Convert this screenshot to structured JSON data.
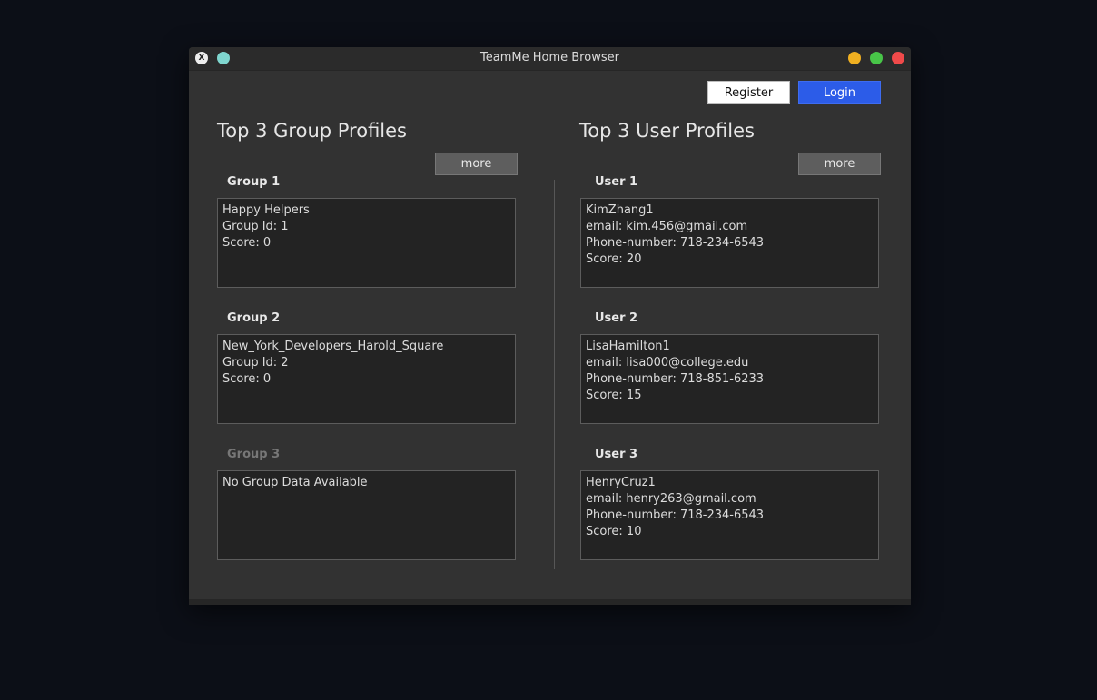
{
  "window": {
    "title": "TeamMe Home Browser",
    "close_glyph": "X",
    "colors": {
      "minimize": "#f0b021",
      "maximize": "#48c548",
      "close": "#f04a4a",
      "pin": "#7fd6cf"
    }
  },
  "header": {
    "register_label": "Register",
    "login_label": "Login",
    "login_color": "#2c5ce8"
  },
  "groups": {
    "title": "Top 3 Group Profiles",
    "more_label": "more",
    "items": [
      {
        "label": "Group 1",
        "lines": [
          "Happy Helpers",
          "Group Id: 1",
          "Score: 0"
        ],
        "enabled": true
      },
      {
        "label": "Group 2",
        "lines": [
          "New_York_Developers_Harold_Square",
          "Group Id: 2",
          "Score: 0"
        ],
        "enabled": true
      },
      {
        "label": "Group 3",
        "lines": [
          "No Group Data Available"
        ],
        "enabled": false
      }
    ]
  },
  "users": {
    "title": "Top 3 User Profiles",
    "more_label": "more",
    "items": [
      {
        "label": "User 1",
        "lines": [
          "KimZhang1",
          "email: kim.456@gmail.com",
          "Phone-number: 718-234-6543",
          "Score: 20"
        ],
        "enabled": true
      },
      {
        "label": "User 2",
        "lines": [
          "LisaHamilton1",
          "email: lisa000@college.edu",
          "Phone-number: 718-851-6233",
          "Score: 15"
        ],
        "enabled": true
      },
      {
        "label": "User 3",
        "lines": [
          "HenryCruz1",
          "email: henry263@gmail.com",
          "Phone-number: 718-234-6543",
          "Score: 10"
        ],
        "enabled": true
      }
    ]
  }
}
